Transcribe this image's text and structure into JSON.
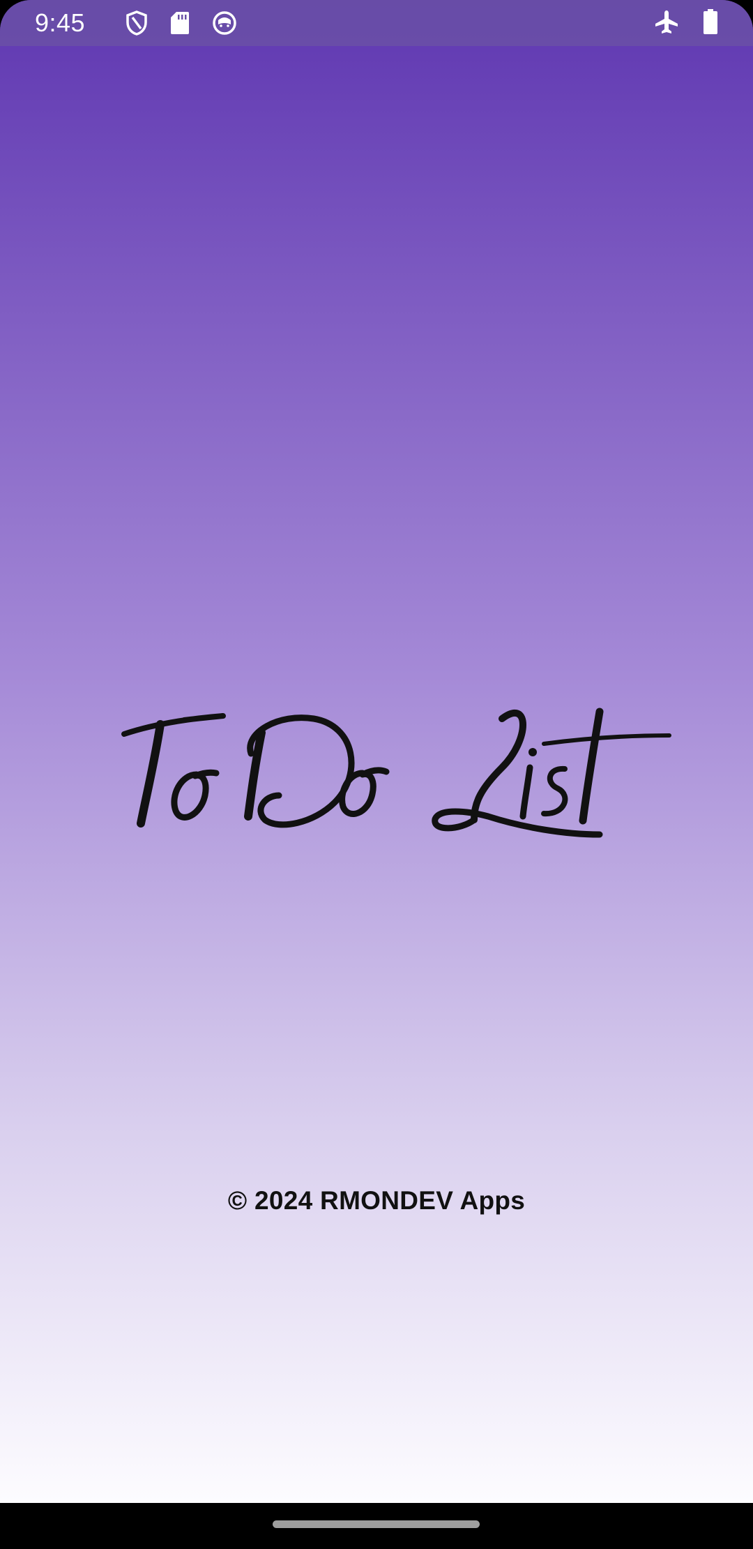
{
  "status_bar": {
    "time": "9:45",
    "left_icons": [
      "shield-icon",
      "sd-card-icon",
      "cat-face-icon"
    ],
    "right_icons": [
      "airplane-mode-icon",
      "battery-icon"
    ]
  },
  "splash": {
    "logo_text": "To Do List",
    "copyright": "© 2024 RMONDEV Apps"
  },
  "colors": {
    "gradient_top": "#5f37b1",
    "gradient_mid": "#a58ad7",
    "gradient_bottom": "#fdfcff",
    "status_bar_bg": "#6a50a6",
    "nav_bar_bg": "#000000",
    "home_handle": "#9e9e9e"
  }
}
